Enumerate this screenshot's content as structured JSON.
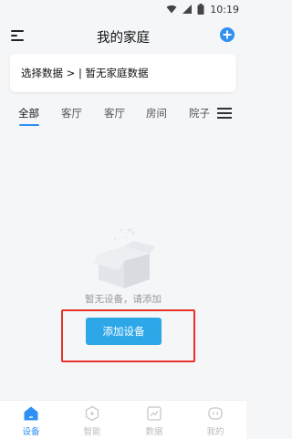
{
  "status_bar": {
    "time": "10:19"
  },
  "header": {
    "title": "我的家庭"
  },
  "data_selector": {
    "text": "选择数据 > | 暂无家庭数据"
  },
  "tabs": [
    {
      "label": "全部",
      "active": true
    },
    {
      "label": "客厅",
      "active": false
    },
    {
      "label": "客厅",
      "active": false
    },
    {
      "label": "房间",
      "active": false
    },
    {
      "label": "院子",
      "active": false
    }
  ],
  "empty_state": {
    "text": "暂无设备，请添加",
    "button_label": "添加设备"
  },
  "bottom_nav": [
    {
      "label": "设备",
      "icon": "home-icon",
      "active": true
    },
    {
      "label": "智能",
      "icon": "smart-icon",
      "active": false
    },
    {
      "label": "数据",
      "icon": "data-icon",
      "active": false
    },
    {
      "label": "我的",
      "icon": "profile-icon",
      "active": false
    }
  ],
  "colors": {
    "accent": "#2f8ff2",
    "button": "#2ea7e8",
    "highlight": "#e8332b"
  }
}
